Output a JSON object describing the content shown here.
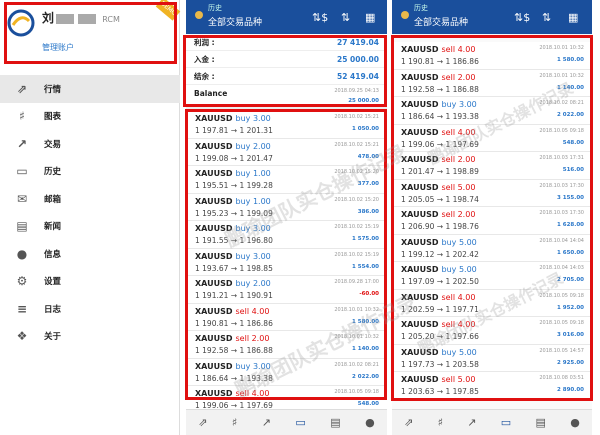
{
  "drawer": {
    "user_name": "刘",
    "account_suffix": "RCM",
    "manage_label": "管理账户",
    "ribbon": "DEMO",
    "items": [
      {
        "label": "行情",
        "icon": "quotes-icon",
        "glyph": "⇗"
      },
      {
        "label": "图表",
        "icon": "chart-icon",
        "glyph": "♯"
      },
      {
        "label": "交易",
        "icon": "trade-icon",
        "glyph": "↗"
      },
      {
        "label": "历史",
        "icon": "history-icon",
        "glyph": "▭"
      },
      {
        "label": "邮箱",
        "icon": "mail-icon",
        "glyph": "✉"
      },
      {
        "label": "新闻",
        "icon": "news-icon",
        "glyph": "▤"
      },
      {
        "label": "信息",
        "icon": "chat-icon",
        "glyph": "●"
      },
      {
        "label": "设置",
        "icon": "settings-icon",
        "glyph": "⚙"
      },
      {
        "label": "日志",
        "icon": "log-icon",
        "glyph": "≡"
      },
      {
        "label": "关于",
        "icon": "about-icon",
        "glyph": "❖"
      }
    ]
  },
  "header": {
    "subtitle": "历史",
    "title": "全部交易品种"
  },
  "summary": {
    "rows": [
      {
        "label": "利润 :",
        "value": "27 419.04"
      },
      {
        "label": "入金 :",
        "value": "25 000.00"
      },
      {
        "label": "结余 :",
        "value": "52 419.04"
      }
    ],
    "balance_label": "Balance",
    "balance_date": "2018.09.25 04:13",
    "balance_value": "25 000.00"
  },
  "trades_left": [
    {
      "symbol": "XAUUSD",
      "side": "buy 3.00",
      "prices": "1 197.81 → 1 201.31",
      "date": "2018.10.02 15:21",
      "profit": "1 050.00"
    },
    {
      "symbol": "XAUUSD",
      "side": "buy 2.00",
      "prices": "1 199.08 → 1 201.47",
      "date": "2018.10.02 15:21",
      "profit": "478.00"
    },
    {
      "symbol": "XAUUSD",
      "side": "buy 1.00",
      "prices": "1 195.51 → 1 199.28",
      "date": "2018.10.02 15:20",
      "profit": "377.00"
    },
    {
      "symbol": "XAUUSD",
      "side": "buy 1.00",
      "prices": "1 195.23 → 1 199.09",
      "date": "2018.10.02 15:20",
      "profit": "386.00"
    },
    {
      "symbol": "XAUUSD",
      "side": "buy 3.00",
      "prices": "1 191.55 → 1 196.80",
      "date": "2018.10.02 15:19",
      "profit": "1 575.00"
    },
    {
      "symbol": "XAUUSD",
      "side": "buy 3.00",
      "prices": "1 193.67 → 1 198.85",
      "date": "2018.10.02 15:19",
      "profit": "1 554.00"
    },
    {
      "symbol": "XAUUSD",
      "side": "buy 2.00",
      "prices": "1 191.21 → 1 190.91",
      "date": "2018.09.28 17:00",
      "profit": "-60.00"
    },
    {
      "symbol": "XAUUSD",
      "side": "sell 4.00",
      "prices": "1 190.81 → 1 186.86",
      "date": "2018.10.01 10:32",
      "profit": "1 580.00"
    },
    {
      "symbol": "XAUUSD",
      "side": "sell 2.00",
      "prices": "1 192.58 → 1 186.88",
      "date": "2018.10.01 10:32",
      "profit": "1 140.00"
    },
    {
      "symbol": "XAUUSD",
      "side": "buy 3.00",
      "prices": "1 186.64 → 1 193.38",
      "date": "2018.10.02 08:21",
      "profit": "2 022.00"
    },
    {
      "symbol": "XAUUSD",
      "side": "sell 4.00",
      "prices": "1 199.06 → 1 197.69",
      "date": "2018.10.05 09:18",
      "profit": "548.00"
    }
  ],
  "trades_right": [
    {
      "symbol": "XAUUSD",
      "side": "sell 4.00",
      "prices": "1 190.81 → 1 186.86",
      "date": "2018.10.01 10:32",
      "profit": "1 580.00"
    },
    {
      "symbol": "XAUUSD",
      "side": "sell 2.00",
      "prices": "1 192.58 → 1 186.88",
      "date": "2018.10.01 10:32",
      "profit": "1 140.00"
    },
    {
      "symbol": "XAUUSD",
      "side": "buy 3.00",
      "prices": "1 186.64 → 1 193.38",
      "date": "2018.10.02 08:21",
      "profit": "2 022.00"
    },
    {
      "symbol": "XAUUSD",
      "side": "sell 4.00",
      "prices": "1 199.06 → 1 197.69",
      "date": "2018.10.05 09:18",
      "profit": "548.00"
    },
    {
      "symbol": "XAUUSD",
      "side": "sell 2.00",
      "prices": "1 201.47 → 1 198.89",
      "date": "2018.10.03 17:31",
      "profit": "516.00"
    },
    {
      "symbol": "XAUUSD",
      "side": "sell 5.00",
      "prices": "1 205.05 → 1 198.74",
      "date": "2018.10.03 17:30",
      "profit": "3 155.00"
    },
    {
      "symbol": "XAUUSD",
      "side": "sell 2.00",
      "prices": "1 206.90 → 1 198.76",
      "date": "2018.10.03 17:30",
      "profit": "1 628.00"
    },
    {
      "symbol": "XAUUSD",
      "side": "buy 5.00",
      "prices": "1 199.12 → 1 202.42",
      "date": "2018.10.04 14:04",
      "profit": "1 650.00"
    },
    {
      "symbol": "XAUUSD",
      "side": "buy 5.00",
      "prices": "1 197.09 → 1 202.50",
      "date": "2018.10.04 14:03",
      "profit": "2 705.00"
    },
    {
      "symbol": "XAUUSD",
      "side": "sell 4.00",
      "prices": "1 202.59 → 1 197.71",
      "date": "2018.10.05 09:18",
      "profit": "1 952.00"
    },
    {
      "symbol": "XAUUSD",
      "side": "sell 4.00",
      "prices": "1 205.20 → 1 197.66",
      "date": "2018.10.05 09:18",
      "profit": "3 016.00"
    },
    {
      "symbol": "XAUUSD",
      "side": "buy 5.00",
      "prices": "1 197.73 → 1 203.58",
      "date": "2018.10.05 14:57",
      "profit": "2 925.00"
    },
    {
      "symbol": "XAUUSD",
      "side": "sell 5.00",
      "prices": "1 203.63 → 1 197.85",
      "date": "2018.10.08 03:51",
      "profit": "2 890.00"
    }
  ],
  "watermark": "鹏瑜团队实仓操作记录",
  "colors": {
    "topbar": "#1a4f9c",
    "buy": "#2a77c9",
    "sell": "#e01010",
    "highlight": "#e01010"
  }
}
